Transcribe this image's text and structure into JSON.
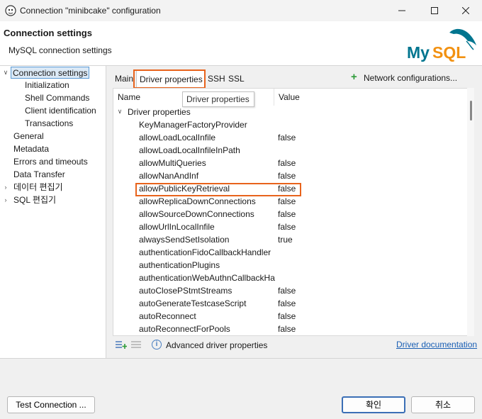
{
  "window": {
    "title": "Connection \"minibcake\" configuration"
  },
  "header": {
    "title": "Connection settings",
    "subtitle": "MySQL connection settings",
    "logo_text": "MySQL"
  },
  "tree": {
    "items": [
      {
        "label": "Connection settings",
        "expanded": true,
        "selected": true
      },
      {
        "label": "Initialization"
      },
      {
        "label": "Shell Commands"
      },
      {
        "label": "Client identification"
      },
      {
        "label": "Transactions"
      },
      {
        "label": "General"
      },
      {
        "label": "Metadata"
      },
      {
        "label": "Errors and timeouts"
      },
      {
        "label": "Data Transfer"
      },
      {
        "label": "데이터 편집기",
        "collapsed": true
      },
      {
        "label": "SQL 편집기",
        "collapsed": true
      }
    ]
  },
  "tabs": {
    "items": [
      {
        "label": "Main"
      },
      {
        "label": "Driver properties",
        "active": true
      },
      {
        "label": "SSH"
      },
      {
        "label": "SSL"
      }
    ],
    "network_config": "Network configurations..."
  },
  "tooltip": "Driver properties",
  "table": {
    "col_name": "Name",
    "col_value": "Value",
    "group": "Driver properties",
    "rows": [
      {
        "name": "KeyManagerFactoryProvider",
        "value": ""
      },
      {
        "name": "allowLoadLocalInfile",
        "value": "false"
      },
      {
        "name": "allowLoadLocalInfileInPath",
        "value": ""
      },
      {
        "name": "allowMultiQueries",
        "value": "false"
      },
      {
        "name": "allowNanAndInf",
        "value": "false"
      },
      {
        "name": "allowPublicKeyRetrieval",
        "value": "false",
        "highlighted": true
      },
      {
        "name": "allowReplicaDownConnections",
        "value": "false"
      },
      {
        "name": "allowSourceDownConnections",
        "value": "false"
      },
      {
        "name": "allowUrlInLocalInfile",
        "value": "false"
      },
      {
        "name": "alwaysSendSetIsolation",
        "value": "true"
      },
      {
        "name": "authenticationFidoCallbackHandler",
        "value": ""
      },
      {
        "name": "authenticationPlugins",
        "value": ""
      },
      {
        "name": "authenticationWebAuthnCallbackHa",
        "value": ""
      },
      {
        "name": "autoClosePStmtStreams",
        "value": "false"
      },
      {
        "name": "autoGenerateTestcaseScript",
        "value": "false"
      },
      {
        "name": "autoReconnect",
        "value": "false"
      },
      {
        "name": "autoReconnectForPools",
        "value": "false"
      }
    ]
  },
  "bottom": {
    "advanced": "Advanced driver properties",
    "doc_link": "Driver documentation"
  },
  "footer": {
    "test_connection": "Test Connection ...",
    "ok": "확인",
    "cancel": "취소"
  },
  "colors": {
    "highlight": "#e8631c",
    "accent": "#3b6fb6",
    "link": "#1a5fb4"
  }
}
